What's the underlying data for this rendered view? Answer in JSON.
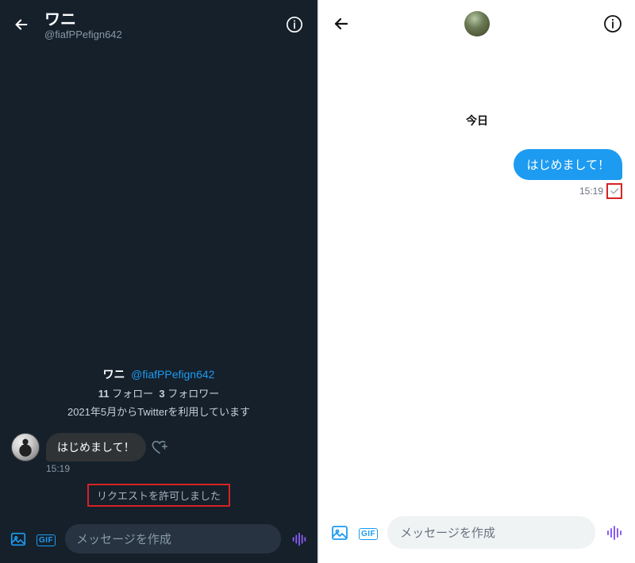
{
  "left": {
    "header": {
      "name": "ワニ",
      "handle": "@fiafPPefign642"
    },
    "profile": {
      "name": "ワニ",
      "handle": "@fiafPPefign642",
      "following_count": "11",
      "following_label": "フォロー",
      "followers_count": "3",
      "followers_label": "フォロワー",
      "since": "2021年5月からTwitterを利用しています"
    },
    "message": {
      "text": "はじめまして！",
      "time": "15:19"
    },
    "system_msg": "リクエストを許可しました",
    "compose_placeholder": "メッセージを作成"
  },
  "right": {
    "date_separator": "今日",
    "message": {
      "text": "はじめまして！",
      "time": "15:19"
    },
    "compose_placeholder": "メッセージを作成"
  },
  "colors": {
    "accent": "#1d9bf0",
    "danger": "#d62323",
    "voice": "#8b5cf6"
  }
}
